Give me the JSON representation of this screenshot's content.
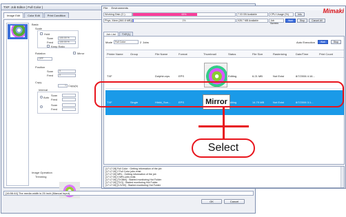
{
  "back_window": {
    "title": "TXF: Job Editor ( Full Color )",
    "tabs": [
      "Image Edit",
      "Color Edit",
      "Print Condition"
    ],
    "section_basic": "Basic",
    "scale_label": "Scale",
    "hold_label": "Hold",
    "scan_label": "Scan",
    "feed_label": "Feed",
    "scan_value": "100.00 %",
    "feed_value": "100.00 %",
    "keep_ratio_label": "Keep Ratio",
    "rotation_label": "Rotation",
    "mirror_label": "Mirror",
    "rotation_value": "OFF",
    "position_label": "Position",
    "pos_scan_value": "0.",
    "pos_feed_value": "0.",
    "copy_label": "Copy",
    "copy_value": "1",
    "copy_unit": "Copy(s)",
    "interval_label": "Interval",
    "auto_label": "Auto",
    "image_operation_label": "Image Operation",
    "trimming_label": "Trimming",
    "status_text": "[16:56:44] The media width is 25 inch (Manual Input).",
    "ok_label": "OK",
    "cancel_label": "Cancel"
  },
  "front_window": {
    "menu": [
      "File",
      "Environments"
    ],
    "logo": "Mimaki",
    "working_disk_label": "Working Disk (C:)",
    "working_disk_percent": "63%",
    "working_disk_fill": 0.63,
    "working_disk_avail": "7.03 GB Available",
    "cpu_label": "CPU Usage (%)",
    "cpu_btn": "Info",
    "phys_mem_label": "Phys. Mem (360.5 MB)",
    "phys_mem_percent": "1%",
    "phys_mem_fill": 0.01,
    "phys_mem_avail": "928.7 MB Available",
    "job_screen_label": "Job Screen",
    "wait_label": "Wait",
    "stop_label": "Stop",
    "cancel_all_label": "Cancel All",
    "tabs": [
      "Job List",
      "TXF(1)"
    ],
    "mode_label": "Mode",
    "mode_value": "Full Color",
    "count_value": "2",
    "count_unit": "Jobs",
    "auto_exec_label": "Auto Execution",
    "auto_wait": "Wait",
    "auto_stop": "Stop",
    "columns": [
      "Printer Name",
      "Group",
      "File Name",
      "Format",
      "Thumbnail",
      "Status",
      "File Size",
      "Rasterizing",
      "Date/Time",
      "Print Count"
    ],
    "row1": [
      "TXF",
      "",
      "Dolphin.eps",
      "EPS",
      "",
      "Editing",
      "6.21 MB",
      "Not Exist",
      "8/7/2006 4:16...",
      ""
    ],
    "row2": [
      "TXF",
      "Single",
      "Hibiki_Sun...",
      "EPS",
      "",
      "Editing",
      "14.79 MB",
      "Not Exist",
      "8/7/2006 3:1...",
      ""
    ],
    "mirror_text": "Mirror",
    "log_lines": [
      "[17:17:28] Full Color : Getting information of the job",
      "[17:17:30] 2 Full Color jobs exist.",
      "[17:17:30] MRL : Getting information of the job",
      "[17:17:30] 0 MRL jobs exist.",
      "[17:17:30] [TX3Bm] : Started monitoring Hot Folder",
      "[17:17:30] [TX3] : Started monitoring Hot Folder",
      "[17:17:30] [CJV30] : Started monitoring Hot Folder"
    ]
  },
  "annotation": {
    "callout_text": "Select",
    "outline_color": "#e8141c"
  },
  "colors": {
    "working_disk_bar": "#ff3d9a",
    "phys_mem_bar": "#5c6cff",
    "selected_row": "#1a9ae8"
  }
}
